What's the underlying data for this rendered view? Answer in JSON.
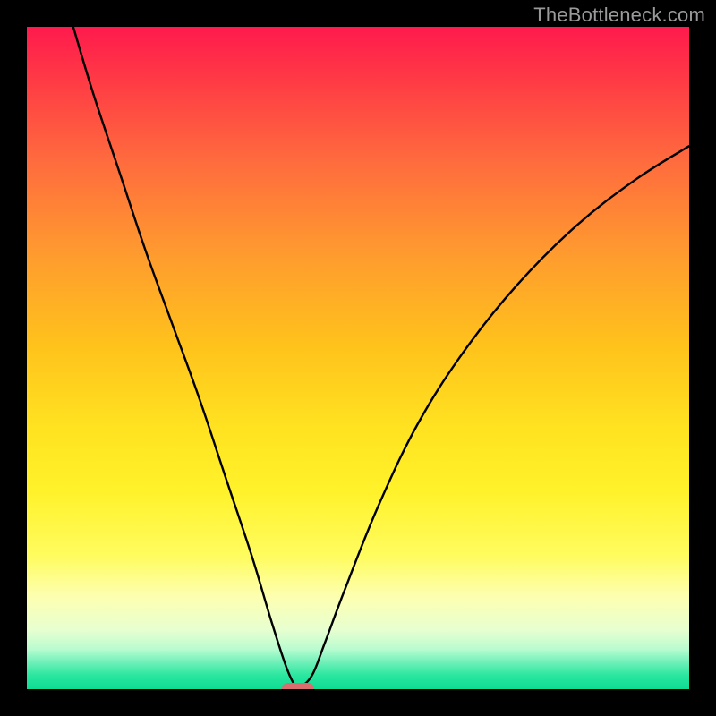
{
  "watermark": {
    "text": "TheBottleneck.com"
  },
  "chart_data": {
    "type": "line",
    "title": "",
    "xlabel": "",
    "ylabel": "",
    "x_range": [
      0,
      100
    ],
    "y_range": [
      0,
      100
    ],
    "background_gradient_stops": [
      {
        "pos": 0,
        "color": "#ff1a4d"
      },
      {
        "pos": 34,
        "color": "#ff9a2f"
      },
      {
        "pos": 60,
        "color": "#ffe120"
      },
      {
        "pos": 86,
        "color": "#fdffb0"
      },
      {
        "pos": 100,
        "color": "#0fdc94"
      }
    ],
    "curve_description": "V-shaped bottleneck curve: steep drop from top-left to a minimum near x≈41, then a slower rise toward the upper-right; minimum y≈0",
    "curve_points": [
      {
        "x": 7.0,
        "y": 100.0
      },
      {
        "x": 10.0,
        "y": 90.0
      },
      {
        "x": 14.0,
        "y": 78.0
      },
      {
        "x": 18.0,
        "y": 66.0
      },
      {
        "x": 22.0,
        "y": 55.0
      },
      {
        "x": 26.0,
        "y": 44.0
      },
      {
        "x": 30.0,
        "y": 32.0
      },
      {
        "x": 34.0,
        "y": 20.0
      },
      {
        "x": 37.0,
        "y": 10.0
      },
      {
        "x": 39.5,
        "y": 2.5
      },
      {
        "x": 41.0,
        "y": 0.5
      },
      {
        "x": 43.0,
        "y": 2.0
      },
      {
        "x": 45.0,
        "y": 7.0
      },
      {
        "x": 48.0,
        "y": 15.0
      },
      {
        "x": 53.0,
        "y": 27.5
      },
      {
        "x": 59.0,
        "y": 40.0
      },
      {
        "x": 66.0,
        "y": 51.0
      },
      {
        "x": 74.0,
        "y": 61.0
      },
      {
        "x": 83.0,
        "y": 70.0
      },
      {
        "x": 92.0,
        "y": 77.0
      },
      {
        "x": 100.0,
        "y": 82.0
      }
    ],
    "marker": {
      "x": 41.0,
      "y": 0.0,
      "color": "#da6e6e"
    }
  }
}
